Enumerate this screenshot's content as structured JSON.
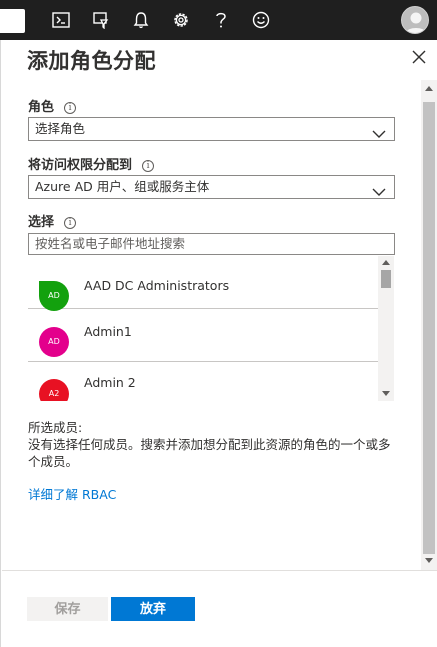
{
  "header": {
    "icons": [
      "cloud-shell-icon",
      "directory-filter-icon",
      "notifications-icon",
      "settings-icon",
      "help-icon",
      "feedback-icon"
    ],
    "bg_color": "#1f1f1f"
  },
  "panel": {
    "title": "添加角色分配",
    "role": {
      "label": "角色",
      "value": "选择角色"
    },
    "assign_access": {
      "label": "将访问权限分配到",
      "value": "Azure AD 用户、组或服务主体"
    },
    "select": {
      "label": "选择",
      "placeholder": "按姓名或电子邮件地址搜索"
    },
    "members": [
      {
        "name": "AAD DC Administrators",
        "initials": "AD",
        "color": "#13a10e"
      },
      {
        "name": "Admin1",
        "initials": "AD",
        "color": "#e3008c"
      },
      {
        "name": "Admin 2",
        "initials": "A2",
        "color": "#e81123"
      }
    ],
    "selected_members": {
      "title": "所选成员:",
      "text": "没有选择任何成员。搜索并添加想分配到此资源的角色的一个或多个成员。"
    },
    "learn_more": "详细了解 RBAC",
    "buttons": {
      "save": "保存",
      "discard": "放弃"
    }
  },
  "colors": {
    "accent": "#0078d4"
  }
}
